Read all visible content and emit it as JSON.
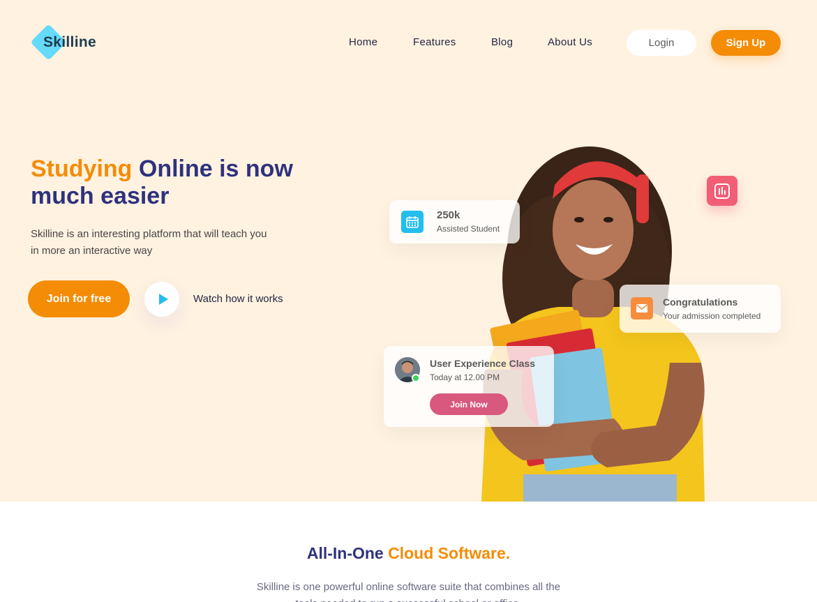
{
  "brand": {
    "name": "Skilline",
    "accent": "#65dafc"
  },
  "nav": {
    "items": [
      "Home",
      "Features",
      "Blog",
      "About Us"
    ],
    "login_label": "Login",
    "signup_label": "Sign Up"
  },
  "hero": {
    "headline_accent": "Studying",
    "headline_rest": " Online is now much easier",
    "subtext": "Skilline is an interesting platform that will teach you in more an interactive way",
    "join_label": "Join for free",
    "watch_label": "Watch how it works"
  },
  "cards": {
    "students": {
      "value": "250k",
      "label": "Assisted Student"
    },
    "congrats": {
      "title": "Congratulations",
      "subtitle": "Your admission completed"
    },
    "class": {
      "title": "User Experience Class",
      "time": "Today at 12.00 PM",
      "button": "Join Now"
    }
  },
  "section": {
    "title_main": "All-In-One ",
    "title_accent": "Cloud Software.",
    "text_line1": "Skilline is one powerful online software suite that combines all the",
    "text_line2": "tools needed to run a successful school or office."
  },
  "colors": {
    "orange": "#f48c06",
    "navy": "#2f327d",
    "hero_bg": "#fff2e1",
    "pink": "#d8587e",
    "cyan": "#23bdee"
  }
}
